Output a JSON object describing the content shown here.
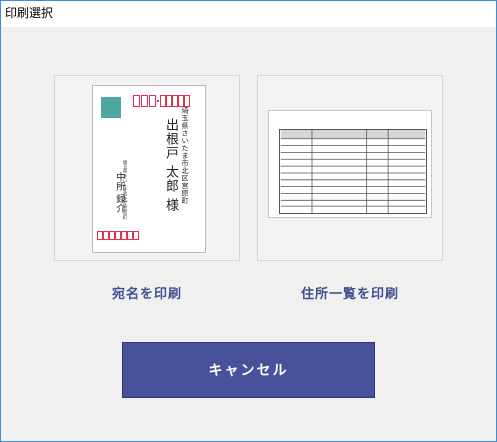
{
  "window": {
    "title": "印刷選択"
  },
  "postcard_preview": {
    "recipient_address": "埼玉県さいたま市北区宮原町",
    "recipient_name": "出根戸 太郎 様",
    "sender_address": "埼玉県さいたま市北区宮原町",
    "sender_name": "中所 録介"
  },
  "options": [
    {
      "label": "宛名を印刷"
    },
    {
      "label": "住所一覧を印刷"
    }
  ],
  "cancel_label": "キャンセル",
  "colors": {
    "accent": "#48529a",
    "caption": "#3f4f8f",
    "stamp": "#4fa6a0",
    "zip_box": "#e0314f"
  }
}
